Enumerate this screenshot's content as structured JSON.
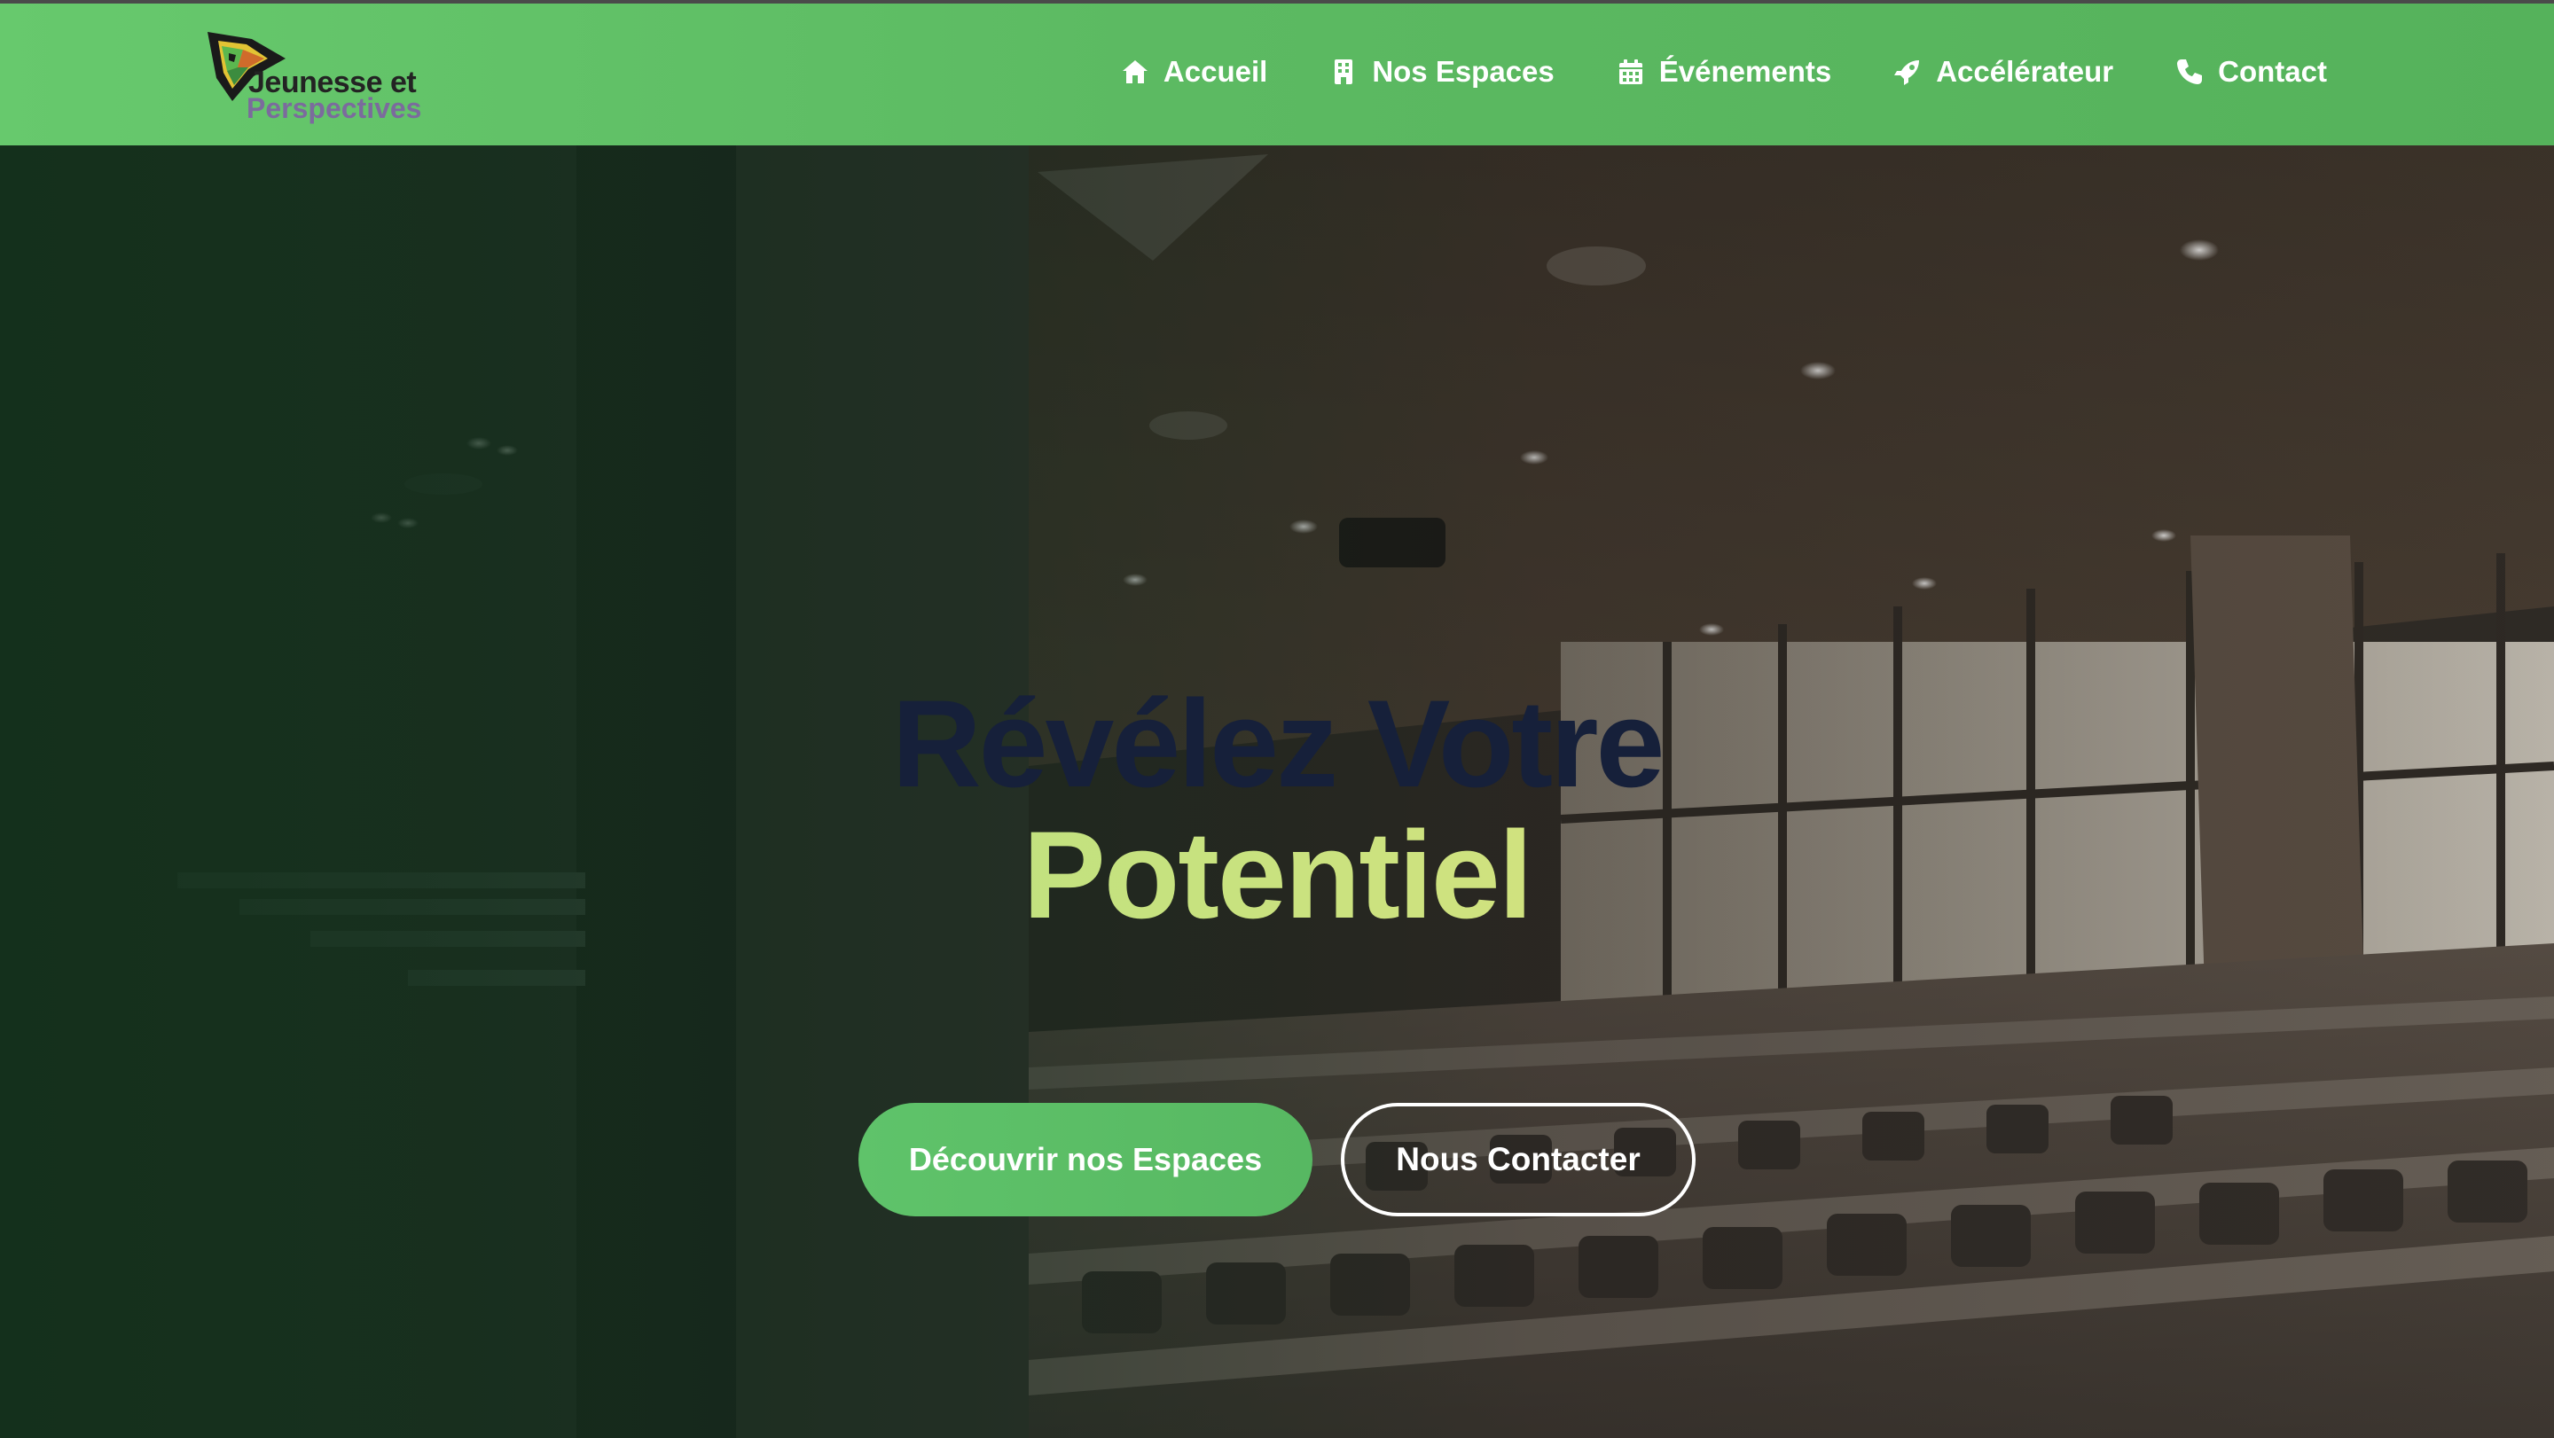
{
  "brand": {
    "name_line1": "Jeunesse et",
    "name_line2": "Perspectives",
    "logo_icon": "cube-logo-icon"
  },
  "nav": {
    "items": [
      {
        "label": "Accueil",
        "icon": "home-icon"
      },
      {
        "label": "Nos Espaces",
        "icon": "building-icon"
      },
      {
        "label": "Événements",
        "icon": "calendar-icon"
      },
      {
        "label": "Accélérateur",
        "icon": "rocket-icon"
      },
      {
        "label": "Contact",
        "icon": "phone-icon"
      }
    ]
  },
  "hero": {
    "title_line1": "Révélez Votre",
    "title_line2": "Potentiel",
    "primary_button": "Découvrir nos Espaces",
    "secondary_button": "Nous Contacter"
  },
  "colors": {
    "nav_green": "#5cba62",
    "title_dark": "#16203a",
    "title_accent": "#c9e584",
    "button_green": "#5cbf67"
  }
}
